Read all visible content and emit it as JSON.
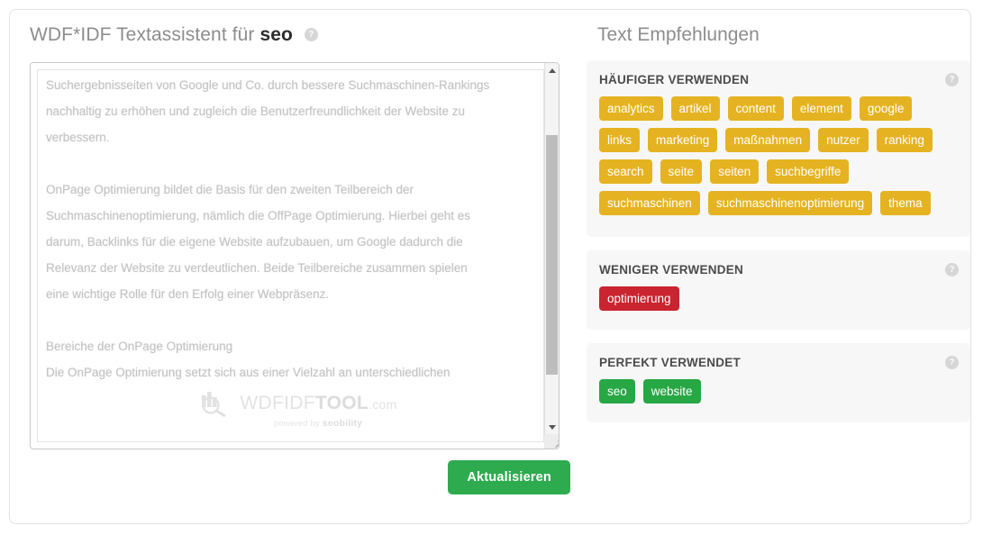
{
  "editor": {
    "title_prefix": "WDF*IDF Textassistent für",
    "keyword": "seo",
    "help_icon": "?",
    "textarea_value": "Suchergebnisseiten von Google und Co. durch bessere Suchmaschinen-Rankings\nnachhaltig zu erhöhen und zugleich die Benutzerfreundlichkeit der Website zu\nverbessern.\n\nOnPage Optimierung bildet die Basis für den zweiten Teilbereich der\nSuchmaschinenoptimierung, nämlich die OffPage Optimierung. Hierbei geht es\ndarum, Backlinks für die eigene Website aufzubauen, um Google dadurch die\nRelevanz der Website zu verdeutlichen. Beide Teilbereiche zusammen spielen\neine wichtige Rolle für den Erfolg einer Webpräsenz.\n\nBereiche der OnPage Optimierung\nDie OnPage Optimierung setzt sich aus einer Vielzahl an unterschiedlichen",
    "watermark": {
      "name_light": "WDFIDF",
      "name_bold": "TOOL",
      "name_tld": ".com",
      "powered_prefix": "powered by",
      "powered_brand": "seobility"
    },
    "update_button": "Aktualisieren"
  },
  "recommendations": {
    "title": "Text Empfehlungen",
    "help_icon": "?",
    "sections": [
      {
        "heading": "HÄUFIGER VERWENDEN",
        "color": "#e5b322",
        "tags": [
          "analytics",
          "artikel",
          "content",
          "element",
          "google",
          "links",
          "marketing",
          "maßnahmen",
          "nutzer",
          "ranking",
          "search",
          "seite",
          "seiten",
          "suchbegriffe",
          "suchmaschinen",
          "suchmaschinenoptimierung",
          "thema"
        ]
      },
      {
        "heading": "WENIGER VERWENDEN",
        "color": "#c9242f",
        "tags": [
          "optimierung"
        ]
      },
      {
        "heading": "PERFEKT VERWENDET",
        "color": "#28a745",
        "tags": [
          "seo",
          "website"
        ]
      }
    ]
  },
  "colors": {
    "gold": "#e5b322",
    "red": "#c9242f",
    "green": "#28a745",
    "button_green": "#2eab4f",
    "panel_bg": "#f7f7f7",
    "title_gray": "#8d8d8d"
  }
}
